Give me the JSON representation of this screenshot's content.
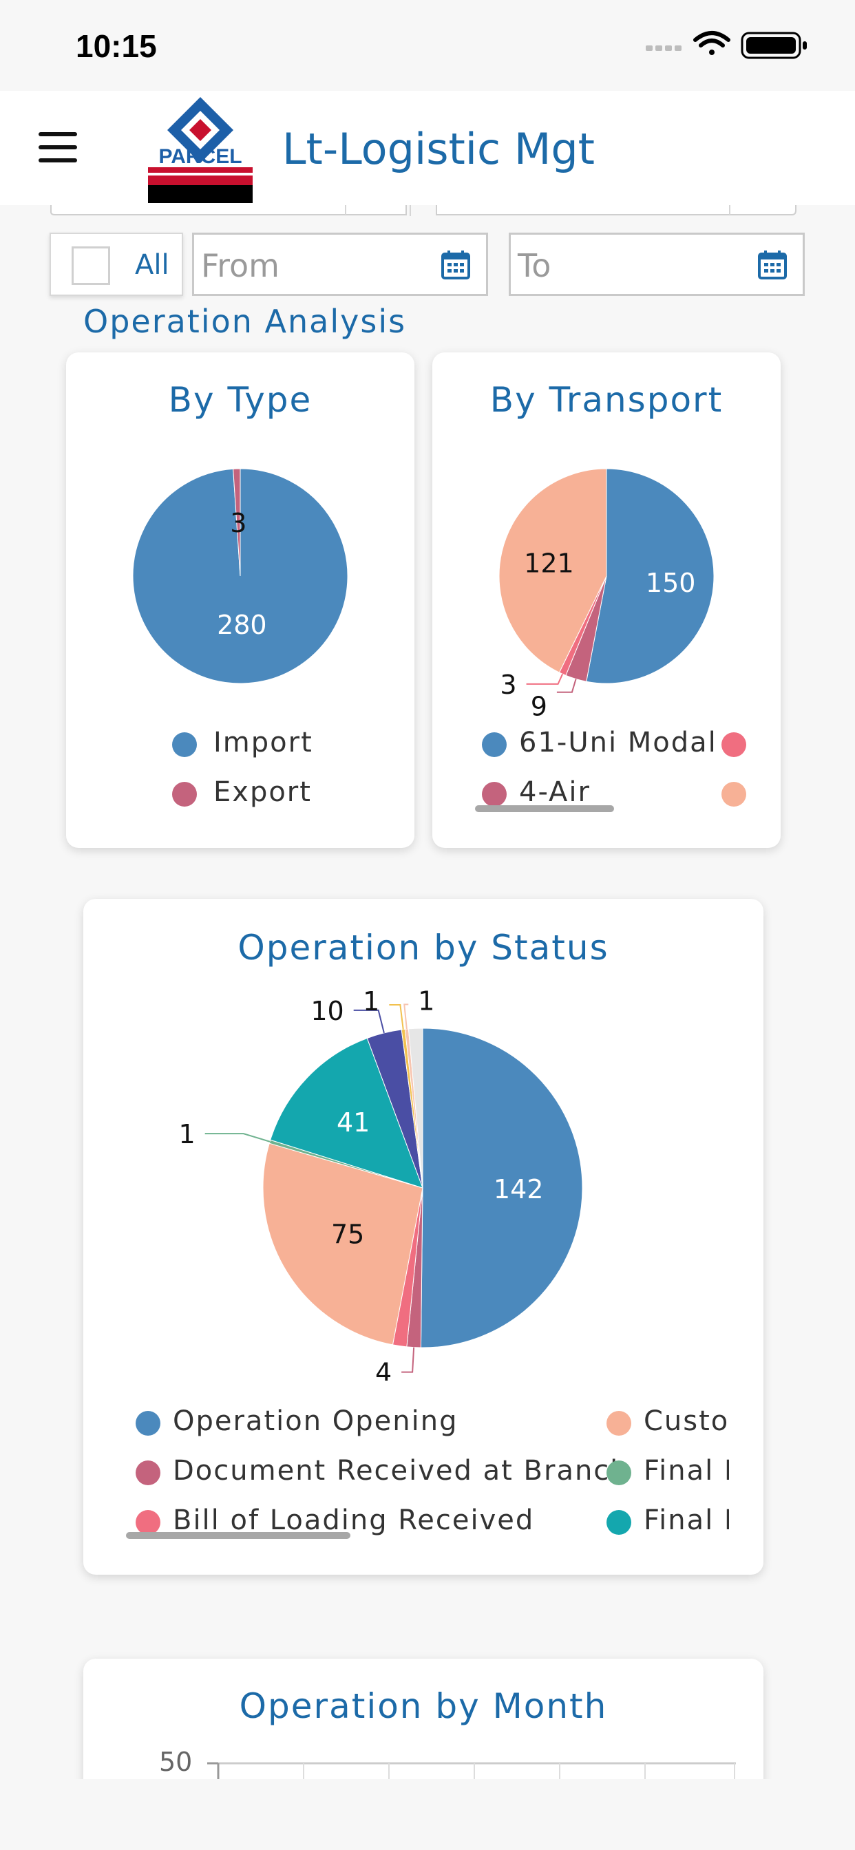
{
  "status_bar": {
    "time": "10:15"
  },
  "header": {
    "title": "Lt-Logistic Mgt",
    "logo_text": "PARCEL"
  },
  "filters": {
    "all_label": "All",
    "from_placeholder": "From",
    "to_placeholder": "To"
  },
  "section": {
    "title": "Operation Analysis"
  },
  "colors": {
    "brand_blue": "#1c6aa8",
    "series_blue": "#4b89bd",
    "series_mauve": "#c4637d",
    "series_salmon": "#f7b196",
    "series_coral": "#f06e80",
    "series_green": "#6fb28f",
    "series_teal": "#14a7ae",
    "series_indigo": "#4a4ea4",
    "series_yellow": "#f2c14e"
  },
  "chart_data": [
    {
      "type": "pie",
      "title": "By Type",
      "series": [
        {
          "name": "Import",
          "value": 280,
          "color": "#4b89bd"
        },
        {
          "name": "Export",
          "value": 3,
          "color": "#c4637d"
        }
      ]
    },
    {
      "type": "pie",
      "title": "By Transport",
      "series": [
        {
          "name": "61-Uni Modal",
          "value": 150,
          "color": "#4b89bd"
        },
        {
          "name": "4-Air",
          "value": 9,
          "color": "#c4637d"
        },
        {
          "name": "",
          "value": 3,
          "color": "#f06e80"
        },
        {
          "name": "",
          "value": 121,
          "color": "#f7b196"
        }
      ]
    },
    {
      "type": "pie",
      "title": "Operation by Status",
      "series": [
        {
          "name": "Operation Opening",
          "value": 142,
          "color": "#4b89bd"
        },
        {
          "name": "Document Received at Branch",
          "value": 4,
          "color": "#c4637d"
        },
        {
          "name": "Bill of Loading Received",
          "value": 4,
          "color": "#f06e80"
        },
        {
          "name": "Custo",
          "value": 75,
          "color": "#f7b196"
        },
        {
          "name": "Final D",
          "value": 1,
          "color": "#6fb28f"
        },
        {
          "name": "Final D",
          "value": 41,
          "color": "#14a7ae"
        },
        {
          "name": "",
          "value": 10,
          "color": "#4a4ea4"
        },
        {
          "name": "",
          "value": 1,
          "color": "#f2c14e"
        },
        {
          "name": "",
          "value": 1,
          "color": "#f7c5b0"
        },
        {
          "name": "",
          "value": 4,
          "color": "#e6e6e6"
        }
      ]
    },
    {
      "type": "bar",
      "title": "Operation by Month",
      "ylim": [
        0,
        50
      ],
      "y_ticks": [
        "50"
      ]
    }
  ]
}
